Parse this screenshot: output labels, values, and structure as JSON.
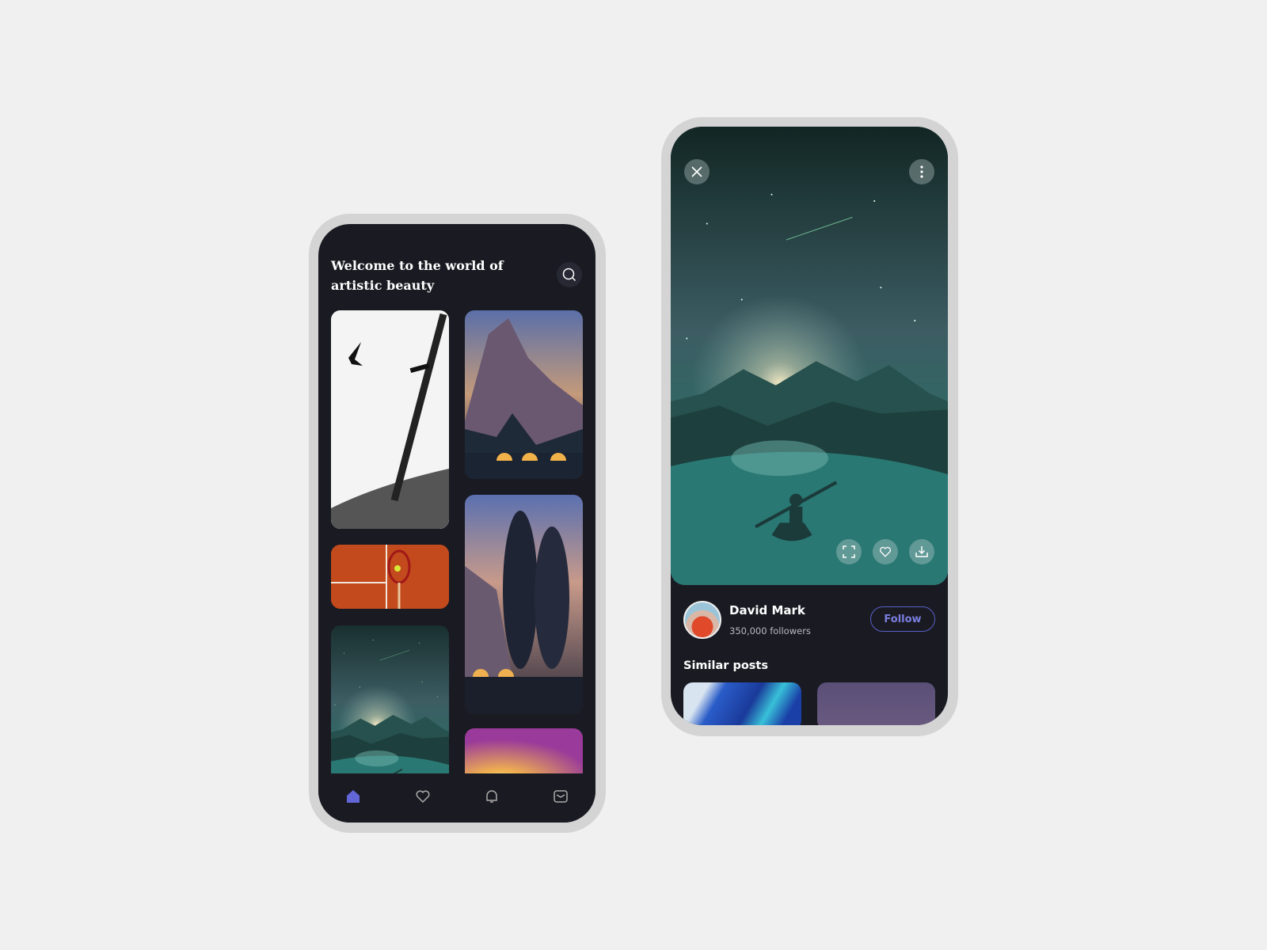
{
  "home": {
    "title": "Welcome to the world of artistic beauty",
    "search_icon": "search-icon",
    "gallery": [
      {
        "subject": "katana with birds"
      },
      {
        "subject": "tennis racket on clay court"
      },
      {
        "subject": "kayak on lake at night"
      },
      {
        "subject": "mountain camp with tents"
      },
      {
        "subject": "tall trees camp at dusk"
      },
      {
        "subject": "sunset"
      }
    ],
    "nav": [
      {
        "icon": "home-icon",
        "active": true
      },
      {
        "icon": "heart-icon"
      },
      {
        "icon": "bell-icon"
      },
      {
        "icon": "mail-icon"
      }
    ],
    "accent": "#6366d6"
  },
  "detail": {
    "close_icon": "close-icon",
    "more_icon": "more-vertical-icon",
    "actions": [
      "fullscreen-icon",
      "heart-icon",
      "download-icon"
    ],
    "author": {
      "name": "David Mark",
      "followers": "350,000 followers"
    },
    "follow_label": "Follow",
    "similar_title": "Similar posts"
  }
}
